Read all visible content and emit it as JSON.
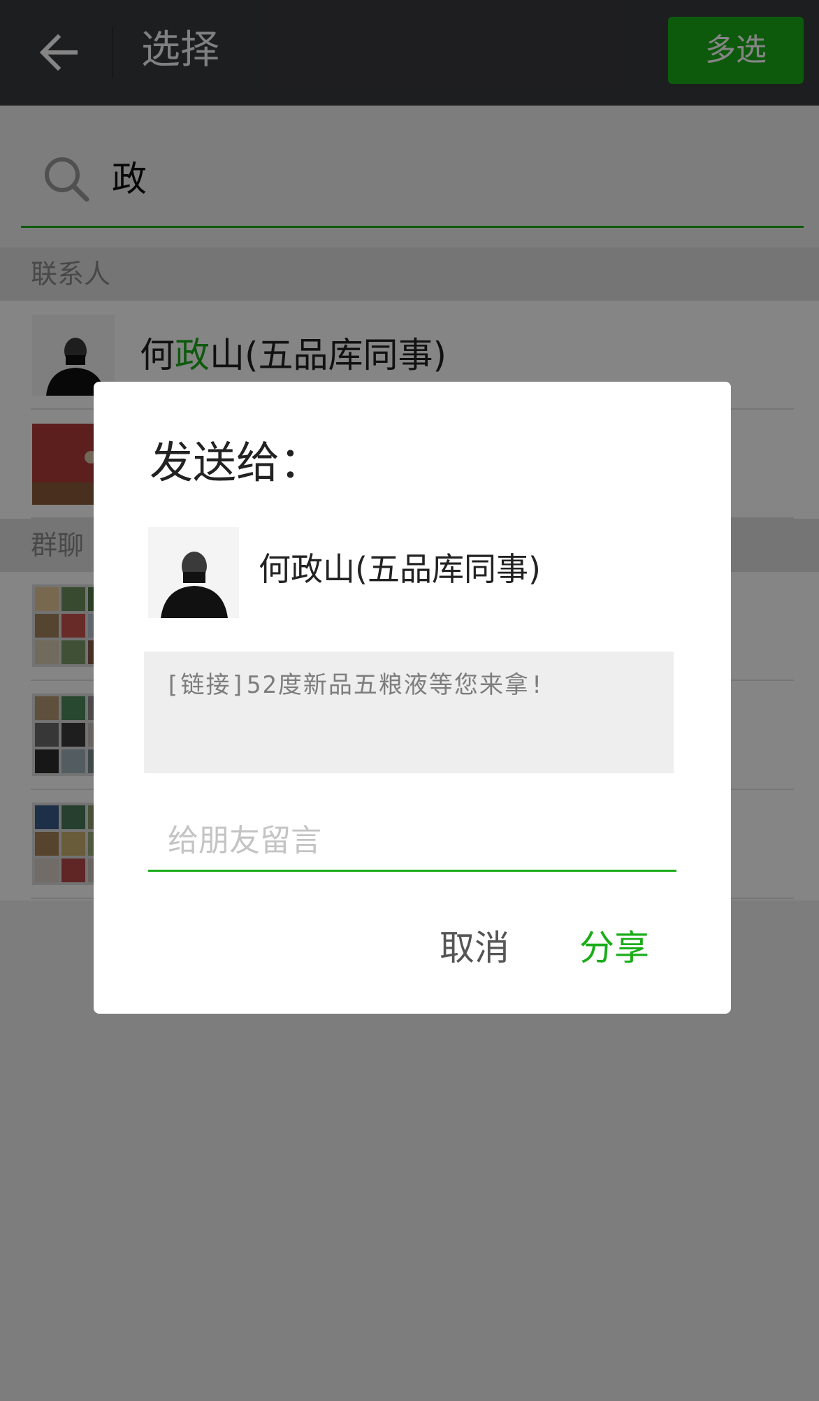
{
  "header": {
    "title": "选择",
    "multi_select_label": "多选"
  },
  "search": {
    "query": "政"
  },
  "sections": {
    "contacts": "联系人",
    "groups": "群聊"
  },
  "contacts": [
    {
      "name_before": "何",
      "name_highlight": "政",
      "name_after": "山(五品库同事)"
    }
  ],
  "dialog": {
    "title": "发送给：",
    "recipient_name": "何政山(五品库同事)",
    "link_text": "[链接]52度新品五粮液等您来拿!",
    "message_placeholder": "给朋友留言",
    "cancel_label": "取消",
    "share_label": "分享"
  },
  "icons": {
    "back": "arrow-left-icon",
    "search": "search-icon"
  },
  "colors": {
    "accent": "#1aad19",
    "topbar": "#393a3f"
  }
}
